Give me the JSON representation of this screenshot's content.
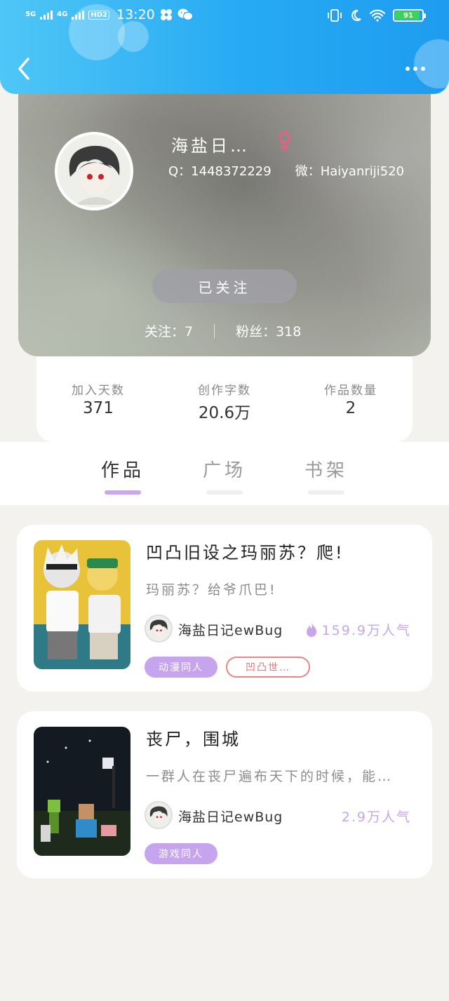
{
  "status_bar": {
    "signal1": "5G",
    "signal2": "4G",
    "hd": "HD2",
    "time": "13:20",
    "battery": "91",
    "battery_level": 0.91
  },
  "profile": {
    "nickname": "海盐日…",
    "gender_symbol": "♀",
    "qq": "Q：1448372229",
    "wechat": "微：Haiyanriji520",
    "follow_button": "已关注",
    "following": "关注：7",
    "fans": "粉丝：318"
  },
  "stats": [
    {
      "label": "加入天数",
      "value": "371"
    },
    {
      "label": "创作字数",
      "value": "20.6万"
    },
    {
      "label": "作品数量",
      "value": "2"
    }
  ],
  "tabs": [
    {
      "label": "作品",
      "active": true
    },
    {
      "label": "广场",
      "active": false
    },
    {
      "label": "书架",
      "active": false
    }
  ],
  "works": [
    {
      "title": "凹凸旧设之玛丽苏？爬!",
      "desc": "玛丽苏？给爷爪巴!",
      "author": "海盐日记ewBug",
      "popularity": "159.9万人气",
      "tags": [
        "动漫同人",
        "凹凸世…"
      ]
    },
    {
      "title": "丧尸，围城",
      "desc": "一群人在丧尸遍布天下的时候，能…",
      "author": "海盐日记ewBug",
      "popularity": "2.9万人气",
      "tags": [
        "游戏同人"
      ]
    }
  ],
  "colors": {
    "header_blue": "#27aaf3",
    "accent_purple": "#c9a6ef",
    "gender_pink": "#e6617f",
    "tag_outline_red": "#e88686"
  }
}
